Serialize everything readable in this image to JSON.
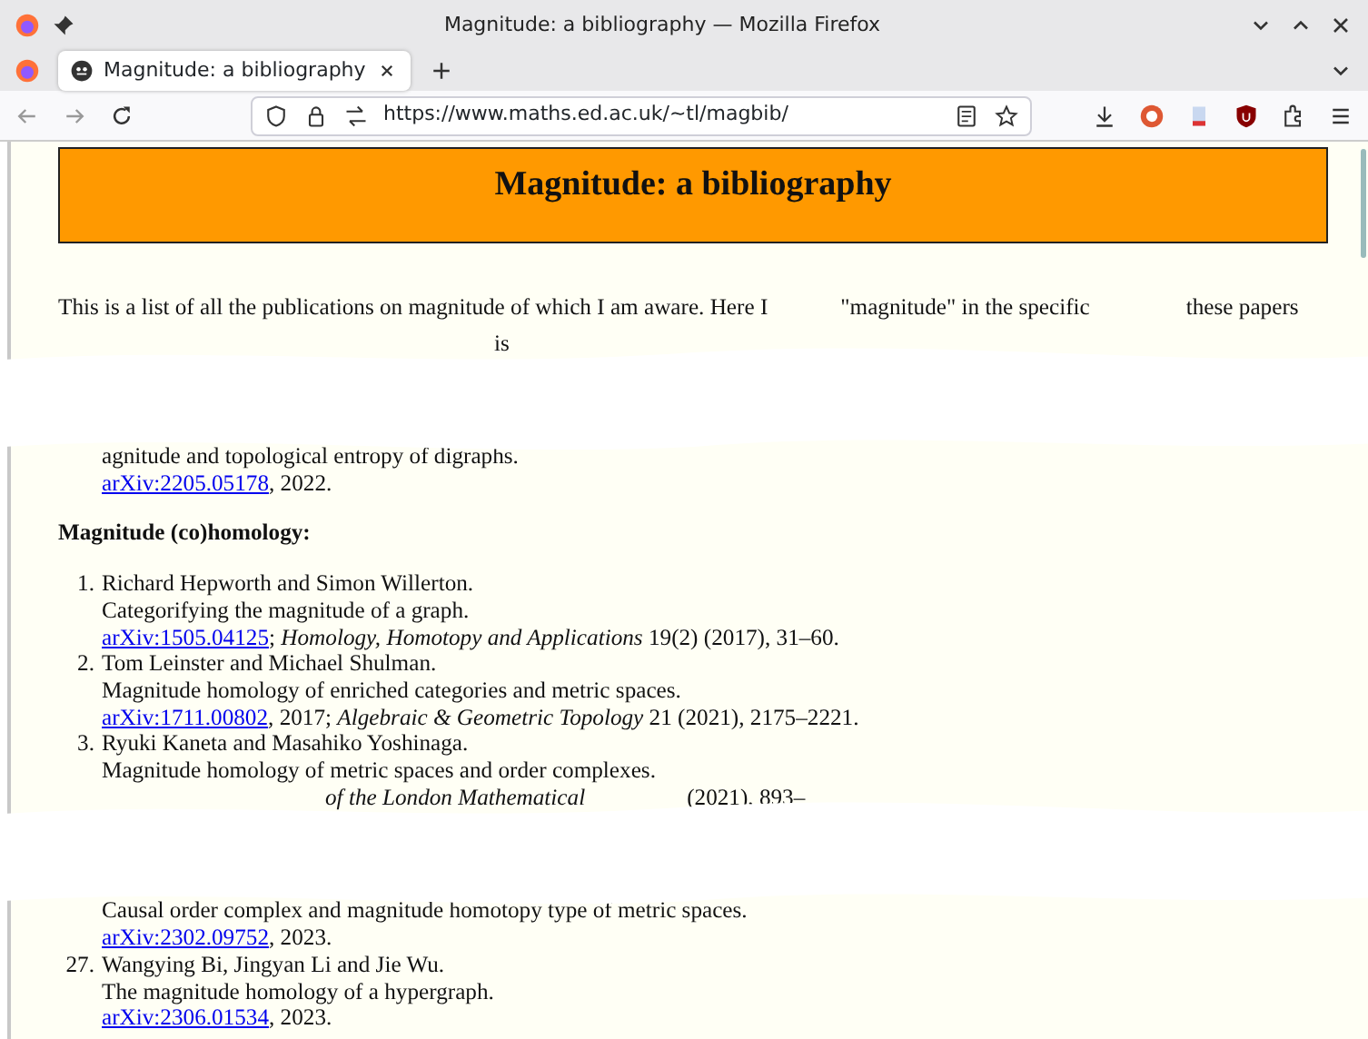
{
  "window": {
    "title": "Magnitude: a bibliography — Mozilla Firefox"
  },
  "tabs": [
    {
      "label": "Magnitude: a bibliography",
      "selected": true
    }
  ],
  "address_bar": {
    "url": "https://www.maths.ed.ac.uk/~tl/magbib/"
  },
  "page": {
    "heading": "Magnitude: a bibliography",
    "blocks": [
      {
        "kind": "fragments",
        "texts": [
          "This is a list of all the publications on magnitude of which I am aware. Here I",
          "\"magnitude\" in the specific",
          "these papers"
        ]
      },
      {
        "kind": "fragments",
        "texts": [
          "is"
        ]
      },
      {
        "kind": "covered"
      },
      {
        "kind": "entry",
        "title": "agnitude and topological entropy of digraphs.",
        "link": "arXiv:2205.05178",
        "rest": ", 2022."
      },
      {
        "kind": "heading",
        "text": "Magnitude (co)homology:"
      },
      {
        "kind": "entry",
        "number": "1.",
        "authors": "Richard Hepworth and Simon Willerton.",
        "title": "Categorifying the magnitude of a graph.",
        "link": "arXiv:1505.04125",
        "rest": "; *Homology, Homotopy and Applications* 19(2) (2017), 31–60."
      },
      {
        "kind": "entry",
        "number": "2.",
        "authors": "Tom Leinster and Michael Shulman.",
        "title": "Magnitude homology of enriched categories and metric spaces.",
        "link": "arXiv:1711.00802",
        "rest": ", 2017; *Algebraic & Geometric Topology* 21 (2021), 2175–2221."
      },
      {
        "kind": "entry",
        "number": "3.",
        "authors": "Ryuki Kaneta and Masahiko Yoshinaga.",
        "title": "Magnitude homology of metric spaces and order complexes.",
        "ref_fragments": [
          "*of the London Mathematical*",
          "(2021), 893–"
        ]
      },
      {
        "kind": "covered"
      },
      {
        "kind": "entry",
        "title": "Causal order complex and magnitude homotopy type of metric spaces.",
        "link": "arXiv:2302.09752",
        "rest": ", 2023."
      },
      {
        "kind": "entry",
        "number": "27.",
        "authors": "Wangying Bi, Jingyan Li and Jie Wu.",
        "title": "The magnitude homology of a hypergraph.",
        "link": "arXiv:2306.01534",
        "rest": ", 2023."
      }
    ]
  }
}
